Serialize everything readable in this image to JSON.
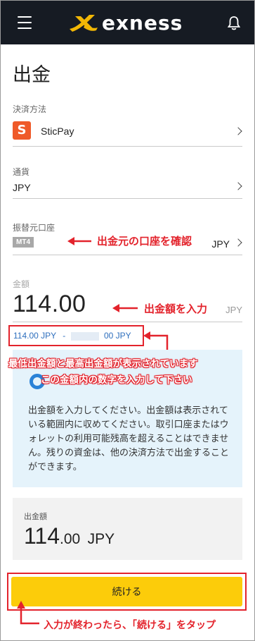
{
  "header": {
    "brand": "exness",
    "menu_icon": "hamburger-menu-icon",
    "bell_icon": "bell-icon",
    "background": "#161b23",
    "logo_color": "#f2b705"
  },
  "page": {
    "title": "出金"
  },
  "payment_method": {
    "label": "決済方法",
    "value": "SticPay",
    "icon_letter": "S"
  },
  "currency": {
    "label": "通貨",
    "value": "JPY"
  },
  "source_account": {
    "label": "振替元口座",
    "badge": "MT4",
    "currency": "JPY"
  },
  "amount": {
    "label": "金額",
    "value": "114.00",
    "unit": "JPY",
    "range_min": "114.00 JPY",
    "range_sep": "-",
    "range_max_tail": "00 JPY"
  },
  "info": {
    "text": "出金額を入力してください。出金額は表示されている範囲内に収めてください。取引口座またはウォレットの利用可能残高を超えることはできません。残りの資金は、他の決済方法で出金することができます。"
  },
  "summary": {
    "label": "出金額",
    "amount_int": "114",
    "amount_dec": ".00",
    "unit": "JPY"
  },
  "continue_button": {
    "label": "続ける",
    "color": "#fccc0a"
  },
  "annotations": {
    "source_account": "出金元の口座を確認",
    "amount": "出金額を入力",
    "range_line1": "最低出金額と最高出金額が表示されています",
    "range_line2": "この金額内の数字を入力して下さい",
    "button": "入力が終わったら、「続ける」をタップ",
    "color": "#e3232c"
  }
}
